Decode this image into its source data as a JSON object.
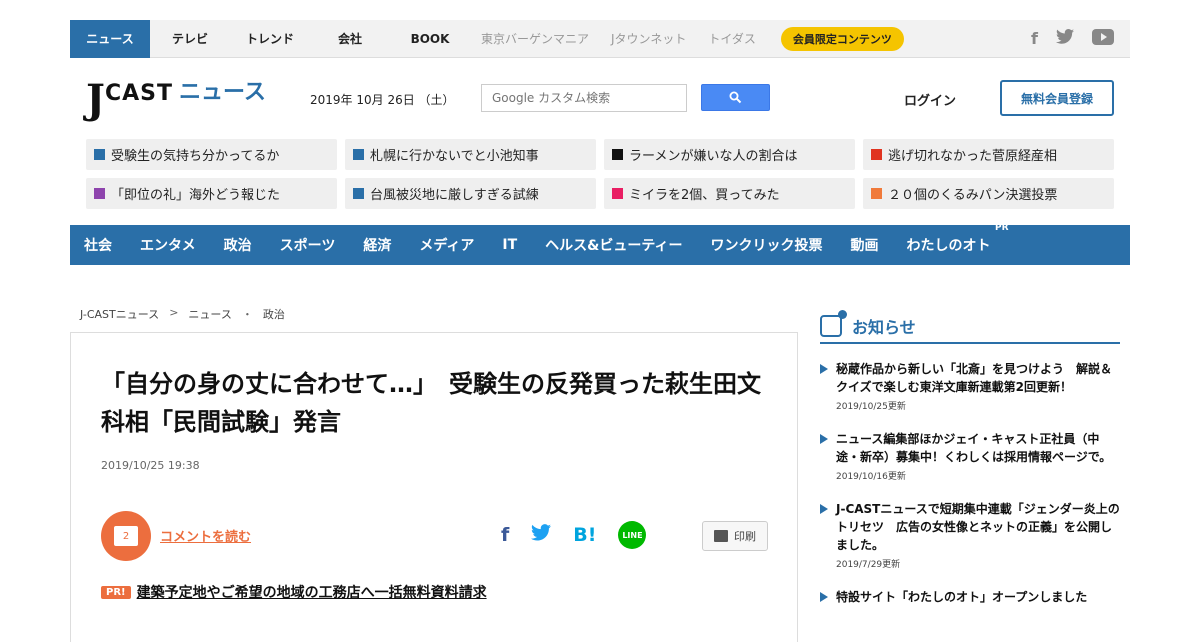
{
  "topbar": {
    "tabs": [
      "ニュース",
      "テレビ",
      "トレンド",
      "会社",
      "BOOK"
    ],
    "muted_links": [
      "東京バーゲンマニア",
      "Jタウンネット",
      "トイダス"
    ],
    "member_label": "会員限定コンテンツ",
    "social_icons": [
      "facebook-icon",
      "twitter-icon",
      "youtube-icon"
    ]
  },
  "header": {
    "logo_j": "J",
    "logo_cast": "CAST",
    "logo_news": "ニュース",
    "date": "2019年 10月 26日 （土）",
    "search_placeholder": "Google カスタム検索",
    "login_label": "ログイン",
    "register_label": "無料会員登録"
  },
  "trending": [
    {
      "label": "受験生の気持ち分かってるか",
      "color": "#2a6fa8"
    },
    {
      "label": "札幌に行かないでと小池知事",
      "color": "#2a6fa8"
    },
    {
      "label": "ラーメンが嫌いな人の割合は",
      "color": "#111111"
    },
    {
      "label": "逃げ切れなかった菅原経産相",
      "color": "#e0331f"
    },
    {
      "label": "「即位の礼」海外どう報じた",
      "color": "#8e44ad"
    },
    {
      "label": "台風被災地に厳しすぎる試練",
      "color": "#2a6fa8"
    },
    {
      "label": "ミイラを2個、買ってみた",
      "color": "#e91e63"
    },
    {
      "label": "２０個のくるみパン決選投票",
      "color": "#f07a3a"
    }
  ],
  "catnav": {
    "items": [
      "社会",
      "エンタメ",
      "政治",
      "スポーツ",
      "経済",
      "メディア",
      "IT",
      "ヘルス&ビューティー",
      "ワンクリック投票",
      "動画",
      "わたしのオト"
    ],
    "pr_label": "PR"
  },
  "breadcrumb": [
    "J-CASTニュース",
    ">",
    "ニュース",
    "・",
    "政治"
  ],
  "article": {
    "headline": "「自分の身の丈に合わせて…」　受験生の反発買った萩生田文科相「民間試験」発言",
    "date": "2019/10/25 19:38",
    "comment_count": "2",
    "comment_link": "コメントを読む",
    "print_label": "印刷",
    "line_label": "LINE",
    "pr_badge": "PR!",
    "pr_link": "建築予定地やご希望の地域の工務店へ一括無料資料請求"
  },
  "sidebar": {
    "title": "お知らせ",
    "notices": [
      {
        "text": "秘蔵作品から新しい「北斎」を見つけよう　解説＆クイズで楽しむ東洋文庫新連載第2回更新！",
        "date": "2019/10/25更新"
      },
      {
        "text": "ニュース編集部ほかジェイ・キャスト正社員（中途・新卒）募集中！くわしくは採用情報ページで。",
        "date": "2019/10/16更新"
      },
      {
        "text": "J-CASTニュースで短期集中連載「ジェンダー炎上のトリセツ　広告の女性像とネットの正義」を公開しました。",
        "date": "2019/7/29更新"
      },
      {
        "text": "特設サイト「わたしのオト」オープンしました",
        "date": ""
      }
    ]
  },
  "colors": {
    "brand_blue": "#2a6fa8",
    "accent_orange": "#ec6e3e",
    "member_yellow": "#f5c400"
  }
}
